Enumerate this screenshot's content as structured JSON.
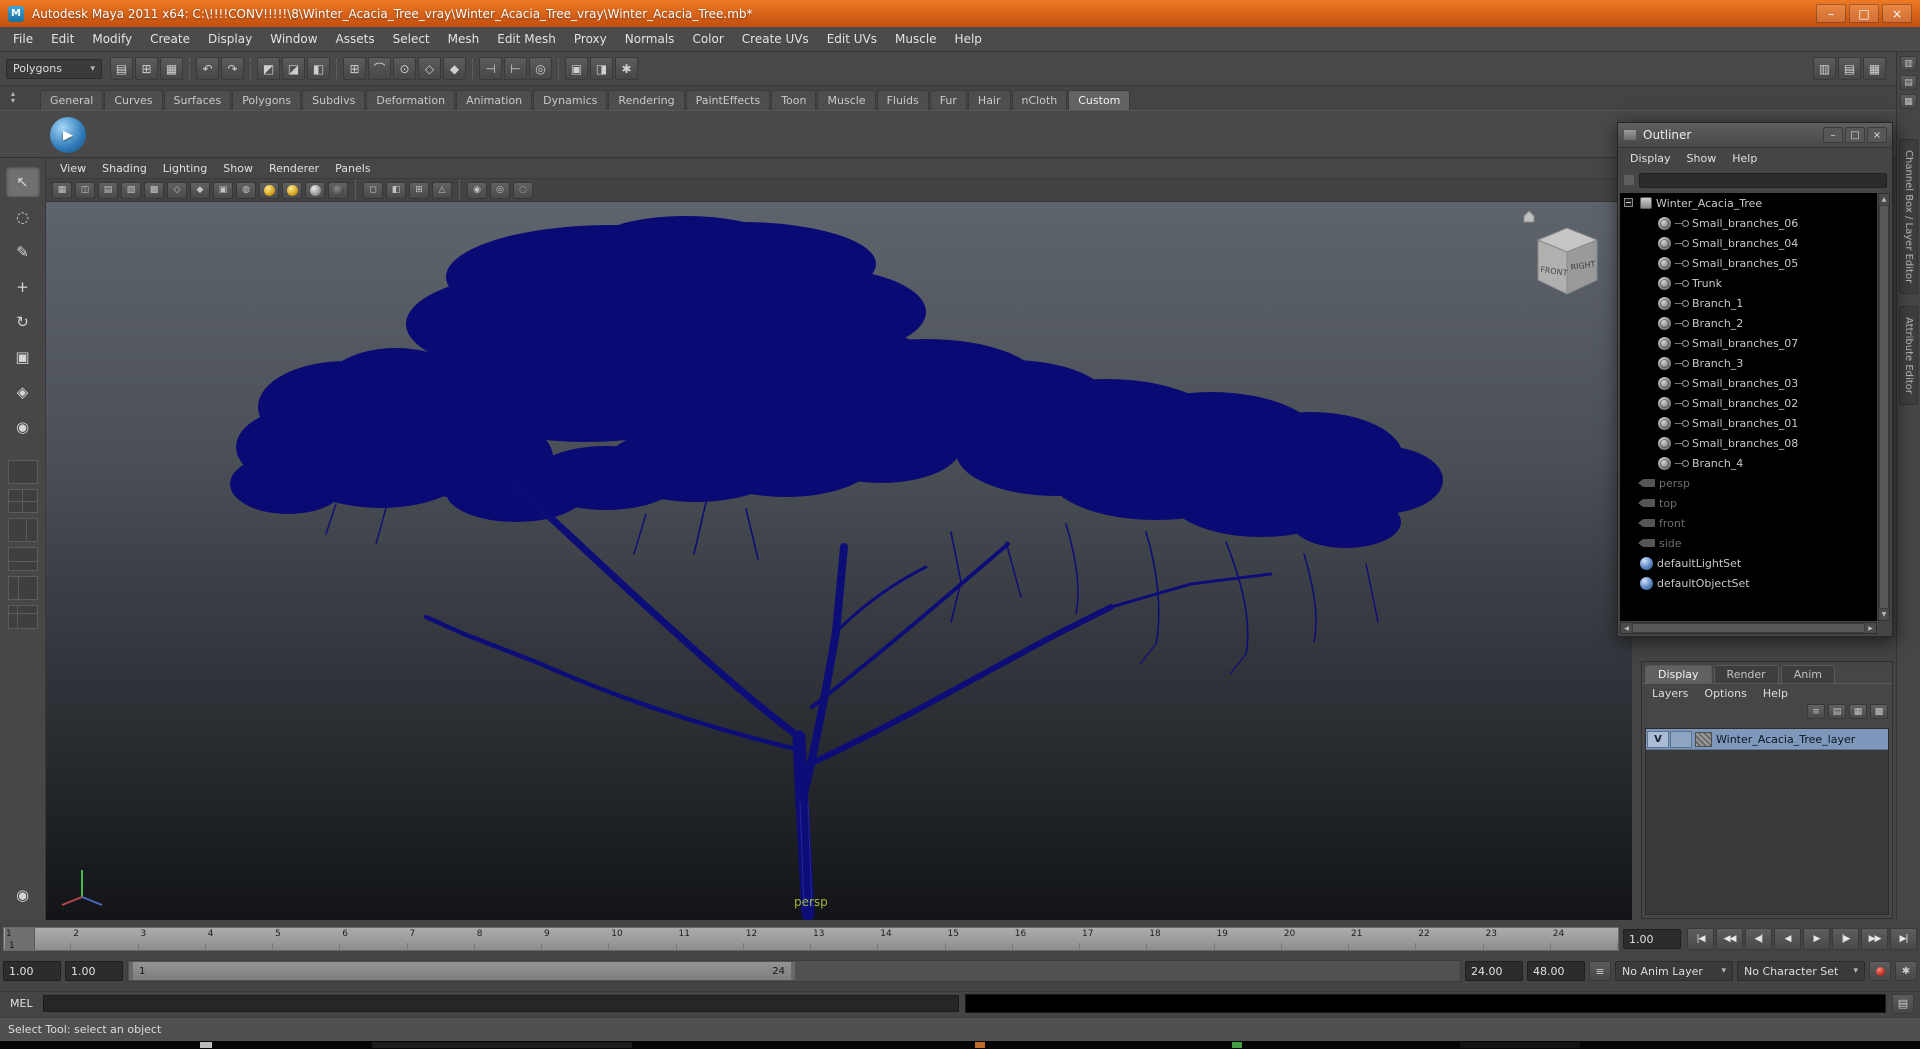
{
  "window": {
    "title": "Autodesk Maya 2011 x64: C:\\!!!!CONV!!!!!\\8\\Winter_Acacia_Tree_vray\\Winter_Acacia_Tree_vray\\Winter_Acacia_Tree.mb*",
    "buttons": [
      {
        "name": "minimize-button",
        "glyph": "–"
      },
      {
        "name": "maximize-button",
        "glyph": "□"
      },
      {
        "name": "close-button",
        "glyph": "×"
      }
    ]
  },
  "menu_bar": {
    "items": [
      "File",
      "Edit",
      "Modify",
      "Create",
      "Display",
      "Window",
      "Assets",
      "Select",
      "Mesh",
      "Edit Mesh",
      "Proxy",
      "Normals",
      "Color",
      "Create UVs",
      "Edit UVs",
      "Muscle",
      "Help"
    ]
  },
  "status_line": {
    "selection_mode": "Polygons",
    "icons": [
      {
        "name": "new-scene-icon",
        "glyph": "▤"
      },
      {
        "name": "open-scene-icon",
        "glyph": "⊞"
      },
      {
        "name": "save-scene-icon",
        "glyph": "▦"
      },
      {
        "name": "divider",
        "glyph": "",
        "cls": "divider",
        "interactable": false
      },
      {
        "name": "undo-icon",
        "glyph": "↶"
      },
      {
        "name": "redo-icon",
        "glyph": "↷"
      },
      {
        "name": "divider",
        "glyph": "",
        "cls": "divider",
        "interactable": false
      },
      {
        "name": "select-hierarchy-icon",
        "glyph": "◩"
      },
      {
        "name": "select-object-icon",
        "glyph": "◪"
      },
      {
        "name": "select-component-icon",
        "glyph": "◧"
      },
      {
        "name": "divider",
        "glyph": "",
        "cls": "divider",
        "interactable": false
      },
      {
        "name": "snap-grid-icon",
        "glyph": "⊞"
      },
      {
        "name": "snap-curve-icon",
        "glyph": "⌒"
      },
      {
        "name": "snap-point-icon",
        "glyph": "⊙"
      },
      {
        "name": "snap-plane-icon",
        "glyph": "◇"
      },
      {
        "name": "snap-mesh-icon",
        "glyph": "◆"
      },
      {
        "name": "divider",
        "glyph": "",
        "cls": "divider",
        "interactable": false
      },
      {
        "name": "input-connections-icon",
        "glyph": "⊣"
      },
      {
        "name": "output-connections-icon",
        "glyph": "⊢"
      },
      {
        "name": "construction-history-icon",
        "glyph": "◎"
      },
      {
        "name": "divider",
        "glyph": "",
        "cls": "divider",
        "interactable": false
      },
      {
        "name": "render-frame-icon",
        "glyph": "▣"
      },
      {
        "name": "ipr-render-icon",
        "glyph": "◨"
      },
      {
        "name": "render-settings-icon",
        "glyph": "✱"
      }
    ],
    "sidebar_toggles": [
      {
        "name": "channel-box-toggle-icon",
        "glyph": "▥"
      },
      {
        "name": "attribute-editor-toggle-icon",
        "glyph": "▤"
      },
      {
        "name": "tool-settings-toggle-icon",
        "glyph": "▦"
      }
    ]
  },
  "shelf": {
    "tabs": [
      {
        "label": "General"
      },
      {
        "label": "Curves"
      },
      {
        "label": "Surfaces"
      },
      {
        "label": "Polygons"
      },
      {
        "label": "Subdivs"
      },
      {
        "label": "Deformation"
      },
      {
        "label": "Animation"
      },
      {
        "label": "Dynamics"
      },
      {
        "label": "Rendering"
      },
      {
        "label": "PaintEffects"
      },
      {
        "label": "Toon"
      },
      {
        "label": "Muscle"
      },
      {
        "label": "Fluids"
      },
      {
        "label": "Fur"
      },
      {
        "label": "Hair"
      },
      {
        "label": "nCloth"
      },
      {
        "label": "Custom",
        "cls": "active"
      }
    ]
  },
  "toolbox": {
    "tools": [
      {
        "name": "select-tool",
        "glyph": "↖",
        "cls": "active"
      },
      {
        "name": "lasso-select-tool",
        "glyph": "◌"
      },
      {
        "name": "paint-select-tool",
        "glyph": "✎"
      },
      {
        "name": "move-tool",
        "glyph": "+"
      },
      {
        "name": "rotate-tool",
        "glyph": "↻"
      },
      {
        "name": "scale-tool",
        "glyph": "▣"
      },
      {
        "name": "universal-manipulator-tool",
        "glyph": "◈"
      },
      {
        "name": "soft-modification-tool",
        "glyph": "◉"
      }
    ],
    "layouts": [
      {
        "name": "layout-single-pane",
        "cls": "l1"
      },
      {
        "name": "layout-four-pane",
        "cls": "l2"
      },
      {
        "name": "layout-persp-outliner",
        "cls": "l3"
      },
      {
        "name": "layout-persp-graph",
        "cls": "l4"
      },
      {
        "name": "layout-hypershade-persp",
        "cls": "l5"
      },
      {
        "name": "layout-custom",
        "cls": "l6"
      }
    ],
    "extra": {
      "glyph": "◉"
    }
  },
  "viewport": {
    "menus": [
      "View",
      "Shading",
      "Lighting",
      "Show",
      "Renderer",
      "Panels"
    ],
    "toolbar_icons": [
      {
        "name": "select-camera-icon",
        "glyph": "▦"
      },
      {
        "name": "lock-camera-icon",
        "glyph": "◫"
      },
      {
        "name": "camera-attributes-icon",
        "glyph": "▤"
      },
      {
        "name": "bookmark-icon",
        "glyph": "▧"
      },
      {
        "name": "image-plane-icon",
        "glyph": "▩"
      },
      {
        "name": "wireframe-mode-icon",
        "glyph": "◇"
      },
      {
        "name": "shaded-mode-icon",
        "glyph": "◆"
      },
      {
        "name": "textured-mode-icon",
        "glyph": "▣"
      },
      {
        "name": "use-default-material-icon",
        "glyph": "◍"
      },
      {
        "name": "default-lighting-icon",
        "glyph": "",
        "cls": "ball yellow"
      },
      {
        "name": "all-lights-icon",
        "glyph": "",
        "cls": "ball yellow"
      },
      {
        "name": "no-lights-icon",
        "glyph": "",
        "cls": "ball gray"
      },
      {
        "name": "shadows-icon",
        "glyph": "",
        "cls": "ball dark"
      },
      {
        "name": "divider",
        "glyph": "",
        "cls": "divider",
        "interactable": false
      },
      {
        "name": "resolution-gate-icon",
        "glyph": "◻"
      },
      {
        "name": "gate-mask-icon",
        "glyph": "◧"
      },
      {
        "name": "field-chart-icon",
        "glyph": "⊞"
      },
      {
        "name": "safe-action-icon",
        "glyph": "△"
      },
      {
        "name": "divider",
        "glyph": "",
        "cls": "divider",
        "interactable": false
      },
      {
        "name": "isolate-select-icon",
        "glyph": "◉"
      },
      {
        "name": "xray-icon",
        "glyph": "◎"
      },
      {
        "name": "grease-pencil-icon",
        "glyph": "◌"
      }
    ],
    "camera_label": "persp",
    "view_cube": {
      "front": "FRONT",
      "right": "RIGHT"
    }
  },
  "outliner": {
    "title": "Outliner",
    "menus": [
      "Display",
      "Show",
      "Help"
    ],
    "buttons": [
      {
        "name": "outliner-minimize-button",
        "glyph": "–"
      },
      {
        "name": "outliner-maximize-button",
        "glyph": "□"
      },
      {
        "name": "outliner-close-button",
        "glyph": "×"
      }
    ],
    "items": [
      {
        "label": "Winter_Acacia_Tree",
        "type": "transform",
        "cls": "root"
      },
      {
        "label": "Small_branches_06",
        "type": "mesh",
        "cls": "child"
      },
      {
        "label": "Small_branches_04",
        "type": "mesh",
        "cls": "child"
      },
      {
        "label": "Small_branches_05",
        "type": "mesh",
        "cls": "child"
      },
      {
        "label": "Trunk",
        "type": "mesh",
        "cls": "child"
      },
      {
        "label": "Branch_1",
        "type": "mesh",
        "cls": "child"
      },
      {
        "label": "Branch_2",
        "type": "mesh",
        "cls": "child"
      },
      {
        "label": "Small_branches_07",
        "type": "mesh",
        "cls": "child"
      },
      {
        "label": "Branch_3",
        "type": "mesh",
        "cls": "child"
      },
      {
        "label": "Small_branches_03",
        "type": "mesh",
        "cls": "child"
      },
      {
        "label": "Small_branches_02",
        "type": "mesh",
        "cls": "child"
      },
      {
        "label": "Small_branches_01",
        "type": "mesh",
        "cls": "child"
      },
      {
        "label": "Small_branches_08",
        "type": "mesh",
        "cls": "child"
      },
      {
        "label": "Branch_4",
        "type": "mesh",
        "cls": "child"
      },
      {
        "label": "persp",
        "type": "camera",
        "cls": "dimmed"
      },
      {
        "label": "top",
        "type": "camera",
        "cls": "dimmed"
      },
      {
        "label": "front",
        "type": "camera",
        "cls": "dimmed"
      },
      {
        "label": "side",
        "type": "camera",
        "cls": "dimmed"
      },
      {
        "label": "defaultLightSet",
        "type": "set"
      },
      {
        "label": "defaultObjectSet",
        "type": "set"
      }
    ]
  },
  "layer_editor": {
    "tabs": [
      {
        "label": "Display",
        "cls": "active"
      },
      {
        "label": "Render"
      },
      {
        "label": "Anim"
      }
    ],
    "menus": [
      "Layers",
      "Options",
      "Help"
    ],
    "icons": [
      {
        "name": "layer-sort-icon",
        "glyph": "≡"
      },
      {
        "name": "layer-move-up-icon",
        "glyph": "▤"
      },
      {
        "name": "new-empty-layer-icon",
        "glyph": "▦"
      },
      {
        "name": "new-layer-from-selected-icon",
        "glyph": "▩"
      }
    ],
    "layers": [
      {
        "visibility": "V",
        "name": "Winter_Acacia_Tree_layer"
      }
    ]
  },
  "side_tabs": {
    "items": [
      "Channel Box / Layer Editor",
      "Attribute Editor"
    ]
  },
  "timeline": {
    "frames": [
      "1",
      "2",
      "3",
      "4",
      "5",
      "6",
      "7",
      "8",
      "9",
      "10",
      "11",
      "12",
      "13",
      "14",
      "15",
      "16",
      "17",
      "18",
      "19",
      "20",
      "21",
      "22",
      "23",
      "24"
    ],
    "current_frame": "1",
    "current_time": "1.00",
    "playback_buttons": [
      {
        "name": "go-to-start-button",
        "glyph": "|◀"
      },
      {
        "name": "step-back-key-button",
        "glyph": "◀◀"
      },
      {
        "name": "step-back-frame-button",
        "glyph": "◀|"
      },
      {
        "name": "play-backwards-button",
        "glyph": "◀"
      },
      {
        "name": "play-forwards-button",
        "glyph": "▶"
      },
      {
        "name": "step-forward-frame-button",
        "glyph": "|▶"
      },
      {
        "name": "step-forward-key-button",
        "glyph": "▶▶"
      },
      {
        "name": "go-to-end-button",
        "glyph": "▶|"
      }
    ]
  },
  "range_slider": {
    "playback_start": "1.00",
    "anim_start": "1.00",
    "range_start": "1",
    "range_end": "24",
    "playback_end": "24.00",
    "anim_end": "48.00",
    "anim_layer": "No Anim Layer",
    "character_set": "No Character Set"
  },
  "command_line": {
    "label": "MEL"
  },
  "help_line": {
    "text": "Select Tool: select an object"
  },
  "colors": {
    "wireframe": "#0a0a75",
    "accent_orange": "#d9571c"
  }
}
